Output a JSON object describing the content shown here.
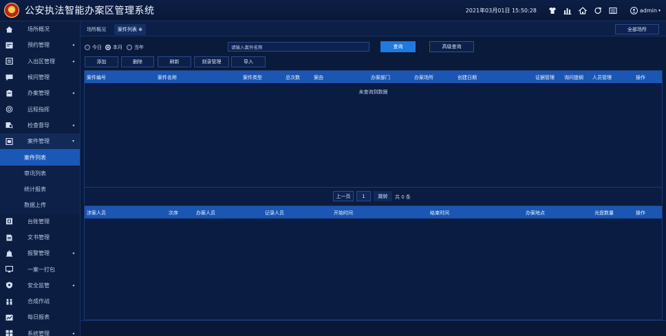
{
  "app": {
    "title": "公安执法智能办案区管理系统"
  },
  "header": {
    "datetime": "2021年03月01日 15:50:28",
    "user": "admin"
  },
  "sidebar": {
    "items": [
      {
        "label": "场所概况",
        "icon": "home-icon",
        "arrow": ""
      },
      {
        "label": "预约管理",
        "icon": "calendar-list-icon",
        "arrow": "◂"
      },
      {
        "label": "入出区管理",
        "icon": "door-icon",
        "arrow": "◂"
      },
      {
        "label": "候问管理",
        "icon": "chat-icon",
        "arrow": ""
      },
      {
        "label": "办案管理",
        "icon": "clipboard-icon",
        "arrow": "◂"
      },
      {
        "label": "远程指挥",
        "icon": "target-icon",
        "arrow": ""
      },
      {
        "label": "检查督导",
        "icon": "inspect-icon",
        "arrow": "◂"
      },
      {
        "label": "案件管理",
        "icon": "case-icon",
        "arrow": "▾"
      }
    ],
    "sub_items": [
      {
        "label": "案件列表"
      },
      {
        "label": "审讯列表"
      },
      {
        "label": "统计报表"
      },
      {
        "label": "数据上传"
      }
    ],
    "items_after": [
      {
        "label": "台账管理",
        "icon": "ledger-icon",
        "arrow": ""
      },
      {
        "label": "文书管理",
        "icon": "document-icon",
        "arrow": ""
      },
      {
        "label": "报警管理",
        "icon": "alarm-icon",
        "arrow": "◂"
      },
      {
        "label": "一案一打包",
        "icon": "monitor-icon",
        "arrow": ""
      },
      {
        "label": "安全监管",
        "icon": "shield-icon",
        "arrow": "◂"
      },
      {
        "label": "合成作战",
        "icon": "team-icon",
        "arrow": ""
      },
      {
        "label": "每日报表",
        "icon": "report-icon",
        "arrow": ""
      },
      {
        "label": "系统管理",
        "icon": "grid-icon",
        "arrow": "◂"
      }
    ]
  },
  "tabs": [
    {
      "label": "场所概况"
    },
    {
      "label": "案件列表 ⊗"
    }
  ],
  "all_places_label": "全部场所",
  "filters": {
    "radios": [
      {
        "label": "今日",
        "selected": false
      },
      {
        "label": "本月",
        "selected": true
      },
      {
        "label": "当年",
        "selected": false
      }
    ],
    "search_placeholder": "请输入案件名称",
    "query_label": "查询",
    "advanced_label": "高级查询"
  },
  "actions": [
    {
      "label": "添加"
    },
    {
      "label": "删除"
    },
    {
      "label": "刷新"
    },
    {
      "label": "刻录管理"
    },
    {
      "label": "导入"
    }
  ],
  "case_table": {
    "columns": [
      "案件编号",
      "案件名称",
      "案件类型",
      "总次数",
      "案由",
      "办案部门",
      "办案场所",
      "创建日期",
      "证据管理",
      "询问提纲",
      "人员管理",
      "操作"
    ],
    "empty_text": "未查询到数据"
  },
  "pager": {
    "prev_label": "上一页",
    "page_value": "1",
    "goto_label": "跳转",
    "total_label": "共 0 条"
  },
  "session_table": {
    "columns": [
      "涉案人员",
      "次序",
      "办案人员",
      "记录人员",
      "开始时间",
      "结束时间",
      "办案地点",
      "光盘数量",
      "操作"
    ]
  }
}
